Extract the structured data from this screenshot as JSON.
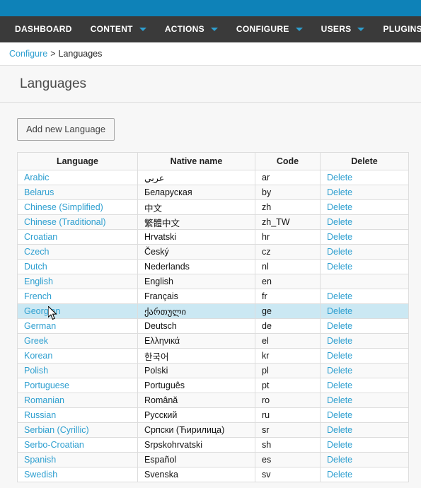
{
  "nav": {
    "items": [
      {
        "label": "DASHBOARD",
        "has_caret": false
      },
      {
        "label": "CONTENT",
        "has_caret": true
      },
      {
        "label": "ACTIONS",
        "has_caret": true
      },
      {
        "label": "CONFIGURE",
        "has_caret": true
      },
      {
        "label": "USERS",
        "has_caret": true
      },
      {
        "label": "PLUGINS",
        "has_caret": true
      }
    ]
  },
  "breadcrumb": {
    "parent": "Configure",
    "separator": ">",
    "current": "Languages"
  },
  "page": {
    "title": "Languages"
  },
  "toolbar": {
    "add_label": "Add new Language"
  },
  "table": {
    "columns": [
      "Language",
      "Native name",
      "Code",
      "Delete"
    ],
    "delete_label": "Delete",
    "rows": [
      {
        "language": "Arabic",
        "native": "عربي",
        "code": "ar",
        "delete": "Delete"
      },
      {
        "language": "Belarus",
        "native": "Беларуская",
        "code": "by",
        "delete": "Delete"
      },
      {
        "language": "Chinese (Simplified)",
        "native": "中文",
        "code": "zh",
        "delete": "Delete"
      },
      {
        "language": "Chinese (Traditional)",
        "native": "繁體中文",
        "code": "zh_TW",
        "delete": "Delete"
      },
      {
        "language": "Croatian",
        "native": "Hrvatski",
        "code": "hr",
        "delete": "Delete"
      },
      {
        "language": "Czech",
        "native": "Český",
        "code": "cz",
        "delete": "Delete"
      },
      {
        "language": "Dutch",
        "native": "Nederlands",
        "code": "nl",
        "delete": "Delete"
      },
      {
        "language": "English",
        "native": "English",
        "code": "en",
        "delete": ""
      },
      {
        "language": "French",
        "native": "Français",
        "code": "fr",
        "delete": "Delete"
      },
      {
        "language": "Georgian",
        "native": "ქართული",
        "code": "ge",
        "delete": "Delete"
      },
      {
        "language": "German",
        "native": "Deutsch",
        "code": "de",
        "delete": "Delete"
      },
      {
        "language": "Greek",
        "native": "Ελληνικά",
        "code": "el",
        "delete": "Delete"
      },
      {
        "language": "Korean",
        "native": "한국어",
        "code": "kr",
        "delete": "Delete"
      },
      {
        "language": "Polish",
        "native": "Polski",
        "code": "pl",
        "delete": "Delete"
      },
      {
        "language": "Portuguese",
        "native": "Português",
        "code": "pt",
        "delete": "Delete"
      },
      {
        "language": "Romanian",
        "native": "Română",
        "code": "ro",
        "delete": "Delete"
      },
      {
        "language": "Russian",
        "native": "Русский",
        "code": "ru",
        "delete": "Delete"
      },
      {
        "language": "Serbian (Cyrillic)",
        "native": "Српски (Ћирилица)",
        "code": "sr",
        "delete": "Delete"
      },
      {
        "language": "Serbo-Croatian",
        "native": "Srpskohrvatski",
        "code": "sh",
        "delete": "Delete"
      },
      {
        "language": "Spanish",
        "native": "Español",
        "code": "es",
        "delete": "Delete"
      },
      {
        "language": "Swedish",
        "native": "Svenska",
        "code": "sv",
        "delete": "Delete"
      }
    ],
    "hovered_row_index": 9
  },
  "colors": {
    "topbar": "#0e82b8",
    "navbar": "#3a3a3a",
    "link": "#2e9fd0",
    "row_hover": "#cbe8f3",
    "panel_bg": "#f7f7f7"
  }
}
